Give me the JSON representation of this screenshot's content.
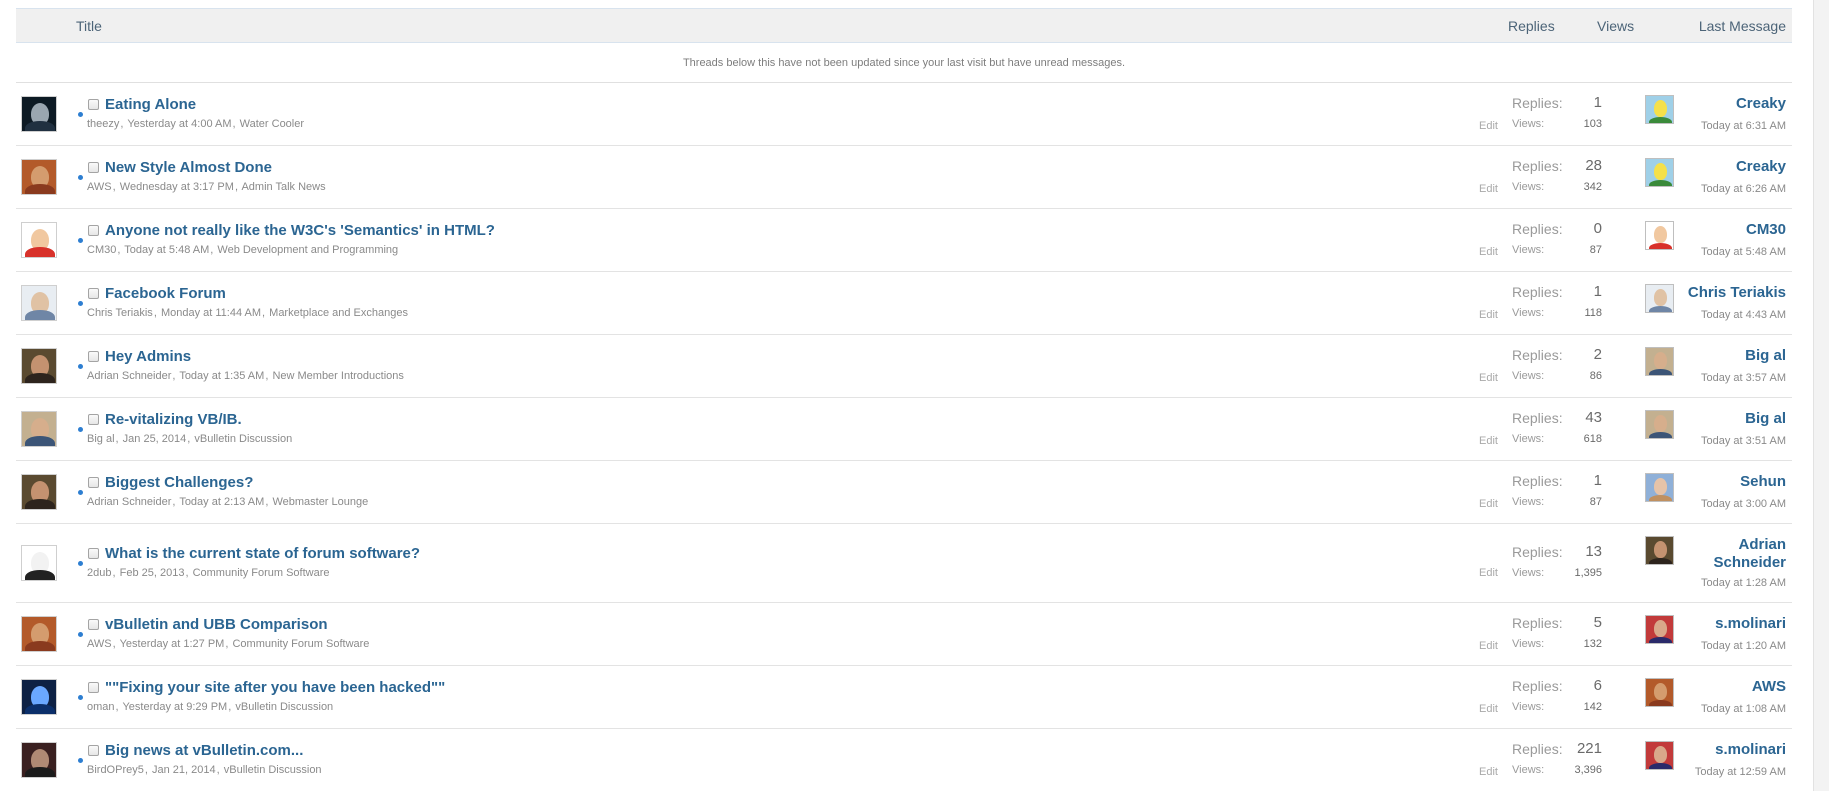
{
  "header": {
    "title": "Title",
    "replies": "Replies",
    "views": "Views",
    "last_message": "Last Message"
  },
  "notice": "Threads below this have not been updated since your last visit but have unread messages.",
  "labels": {
    "replies": "Replies:",
    "views": "Views:",
    "edit": "Edit"
  },
  "colors": {
    "link": "#2b6592",
    "unread_dot": "#2d7ed1",
    "header_bg": "#f0f0f0"
  },
  "threads": [
    {
      "title": "Eating Alone",
      "author": "theezy",
      "date": "Yesterday at 4:00 AM",
      "forum": "Water Cooler",
      "replies": "1",
      "views": "103",
      "last_user": "Creaky",
      "last_time": "Today at 6:31 AM"
    },
    {
      "title": "New Style Almost Done",
      "author": "AWS",
      "date": "Wednesday at 3:17 PM",
      "forum": "Admin Talk News",
      "replies": "28",
      "views": "342",
      "last_user": "Creaky",
      "last_time": "Today at 6:26 AM"
    },
    {
      "title": "Anyone not really like the W3C's 'Semantics' in HTML?",
      "author": "CM30",
      "date": "Today at 5:48 AM",
      "forum": "Web Development and Programming",
      "replies": "0",
      "views": "87",
      "last_user": "CM30",
      "last_time": "Today at 5:48 AM"
    },
    {
      "title": "Facebook Forum",
      "author": "Chris Teriakis",
      "date": "Monday at 11:44 AM",
      "forum": "Marketplace and Exchanges",
      "replies": "1",
      "views": "118",
      "last_user": "Chris Teriakis",
      "last_time": "Today at 4:43 AM"
    },
    {
      "title": "Hey Admins",
      "author": "Adrian Schneider",
      "date": "Today at 1:35 AM",
      "forum": "New Member Introductions",
      "replies": "2",
      "views": "86",
      "last_user": "Big al",
      "last_time": "Today at 3:57 AM"
    },
    {
      "title": "Re-vitalizing VB/IB.",
      "author": "Big al",
      "date": "Jan 25, 2014",
      "forum": "vBulletin Discussion",
      "replies": "43",
      "views": "618",
      "last_user": "Big al",
      "last_time": "Today at 3:51 AM"
    },
    {
      "title": "Biggest Challenges?",
      "author": "Adrian Schneider",
      "date": "Today at 2:13 AM",
      "forum": "Webmaster Lounge",
      "replies": "1",
      "views": "87",
      "last_user": "Sehun",
      "last_time": "Today at 3:00 AM"
    },
    {
      "title": "What is the current state of forum software?",
      "author": "2dub",
      "date": "Feb 25, 2013",
      "forum": "Community Forum Software",
      "replies": "13",
      "views": "1,395",
      "last_user": "Adrian Schneider",
      "last_time": "Today at 1:28 AM"
    },
    {
      "title": "vBulletin and UBB Comparison",
      "author": "AWS",
      "date": "Yesterday at 1:27 PM",
      "forum": "Community Forum Software",
      "replies": "5",
      "views": "132",
      "last_user": "s.molinari",
      "last_time": "Today at 1:20 AM"
    },
    {
      "title": "\"\"Fixing your site after you have been hacked\"\"",
      "author": "oman",
      "date": "Yesterday at 9:29 PM",
      "forum": "vBulletin Discussion",
      "replies": "6",
      "views": "142",
      "last_user": "AWS",
      "last_time": "Today at 1:08 AM"
    },
    {
      "title": "Big news at vBulletin.com...",
      "author": "BirdOPrey5",
      "date": "Jan 21, 2014",
      "forum": "vBulletin Discussion",
      "replies": "221",
      "views": "3,396",
      "last_user": "s.molinari",
      "last_time": "Today at 12:59 AM"
    }
  ]
}
